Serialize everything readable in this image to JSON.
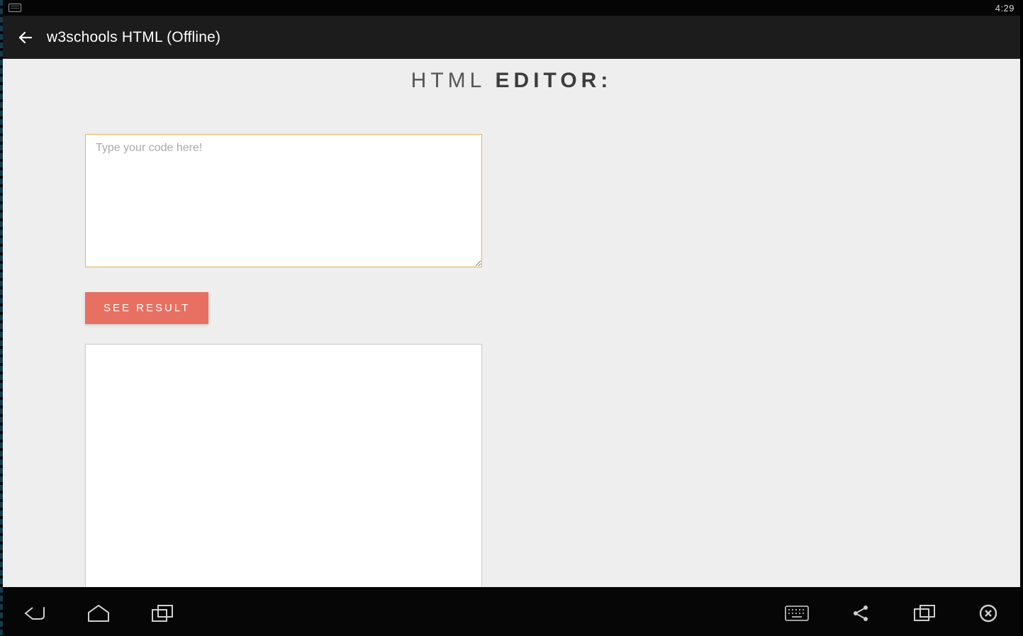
{
  "status": {
    "time": "4:29"
  },
  "appbar": {
    "title": "w3schools HTML (Offline)"
  },
  "page": {
    "heading_light": "HTML ",
    "heading_bold": "EDITOR:"
  },
  "editor": {
    "placeholder": "Type your code here!",
    "value": ""
  },
  "buttons": {
    "see_result": "SEE RESULT"
  }
}
